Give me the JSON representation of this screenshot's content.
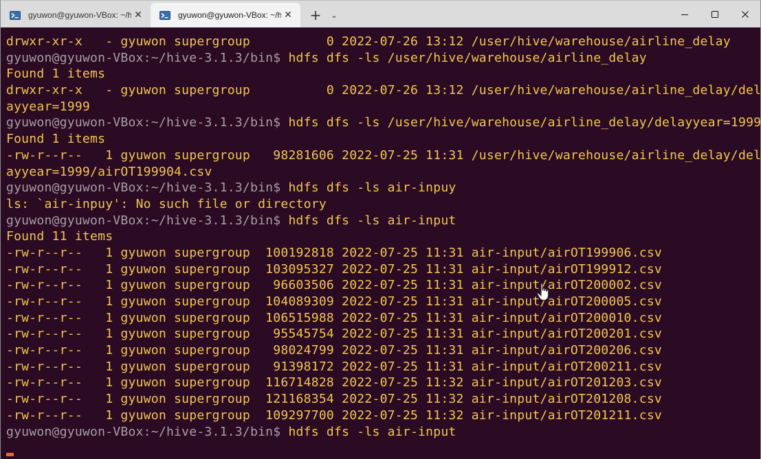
{
  "tabs": [
    {
      "label": "gyuwon@gyuwon-VBox: ~/hiv",
      "active": false
    },
    {
      "label": "gyuwon@gyuwon-VBox: ~/h",
      "active": true
    }
  ],
  "window_controls": {
    "minimize": "─",
    "maximize": "☐",
    "close": "✕"
  },
  "new_tab_glyph": "+",
  "dropdown_glyph": "⌄",
  "tab_close_glyph": "✕",
  "colors": {
    "background": "#2b0a23",
    "text": "#f0c850",
    "prompt": "#a89fa6",
    "cursor": "#e8672b"
  },
  "terminal": {
    "lines": [
      {
        "prompt": "",
        "text": "drwxr-xr-x   - gyuwon supergroup          0 2022-07-26 13:12 /user/hive/warehouse/airline_delay"
      },
      {
        "prompt": "gyuwon@gyuwon-VBox:~/hive-3.1.3/bin$",
        "text": " hdfs dfs -ls /user/hive/warehouse/airline_delay"
      },
      {
        "prompt": "",
        "text": "Found 1 items"
      },
      {
        "prompt": "",
        "text": "drwxr-xr-x   - gyuwon supergroup          0 2022-07-26 13:12 /user/hive/warehouse/airline_delay/del"
      },
      {
        "prompt": "",
        "text": "ayyear=1999"
      },
      {
        "prompt": "gyuwon@gyuwon-VBox:~/hive-3.1.3/bin$",
        "text": " hdfs dfs -ls /user/hive/warehouse/airline_delay/delayyear=1999"
      },
      {
        "prompt": "",
        "text": "Found 1 items"
      },
      {
        "prompt": "",
        "text": "-rw-r--r--   1 gyuwon supergroup   98281606 2022-07-25 11:31 /user/hive/warehouse/airline_delay/del"
      },
      {
        "prompt": "",
        "text": "ayyear=1999/airOT199904.csv"
      },
      {
        "prompt": "gyuwon@gyuwon-VBox:~/hive-3.1.3/bin$",
        "text": " hdfs dfs -ls air-inpuy"
      },
      {
        "prompt": "",
        "text": "ls: `air-inpuy': No such file or directory"
      },
      {
        "prompt": "gyuwon@gyuwon-VBox:~/hive-3.1.3/bin$",
        "text": " hdfs dfs -ls air-input"
      },
      {
        "prompt": "",
        "text": "Found 11 items"
      },
      {
        "prompt": "",
        "text": "-rw-r--r--   1 gyuwon supergroup  100192818 2022-07-25 11:31 air-input/airOT199906.csv"
      },
      {
        "prompt": "",
        "text": "-rw-r--r--   1 gyuwon supergroup  103095327 2022-07-25 11:31 air-input/airOT199912.csv"
      },
      {
        "prompt": "",
        "text": "-rw-r--r--   1 gyuwon supergroup   96603506 2022-07-25 11:31 air-input/airOT200002.csv"
      },
      {
        "prompt": "",
        "text": "-rw-r--r--   1 gyuwon supergroup  104089309 2022-07-25 11:31 air-input/airOT200005.csv"
      },
      {
        "prompt": "",
        "text": "-rw-r--r--   1 gyuwon supergroup  106515988 2022-07-25 11:31 air-input/airOT200010.csv"
      },
      {
        "prompt": "",
        "text": "-rw-r--r--   1 gyuwon supergroup   95545754 2022-07-25 11:31 air-input/airOT200201.csv"
      },
      {
        "prompt": "",
        "text": "-rw-r--r--   1 gyuwon supergroup   98024799 2022-07-25 11:31 air-input/airOT200206.csv"
      },
      {
        "prompt": "",
        "text": "-rw-r--r--   1 gyuwon supergroup   91398172 2022-07-25 11:31 air-input/airOT200211.csv"
      },
      {
        "prompt": "",
        "text": "-rw-r--r--   1 gyuwon supergroup  116714828 2022-07-25 11:32 air-input/airOT201203.csv"
      },
      {
        "prompt": "",
        "text": "-rw-r--r--   1 gyuwon supergroup  121168354 2022-07-25 11:32 air-input/airOT201208.csv"
      },
      {
        "prompt": "",
        "text": "-rw-r--r--   1 gyuwon supergroup  109297700 2022-07-25 11:32 air-input/airOT201211.csv"
      },
      {
        "prompt": "gyuwon@gyuwon-VBox:~/hive-3.1.3/bin$",
        "text": " hdfs dfs -ls air-input"
      }
    ]
  }
}
